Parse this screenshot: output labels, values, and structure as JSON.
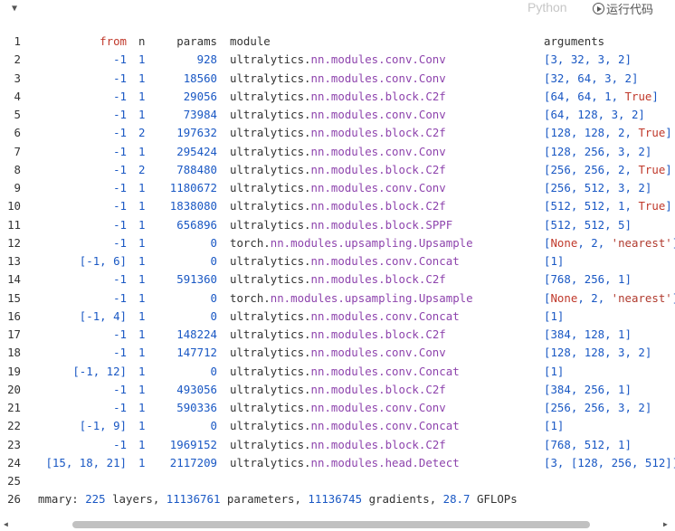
{
  "toolbar": {
    "language": "Python",
    "run_label": "运行代码"
  },
  "header": {
    "ln": "1",
    "from": "from",
    "n": "n",
    "params": "params",
    "module": "module",
    "arguments": "arguments"
  },
  "rows": [
    {
      "ln": "2",
      "from": "-1",
      "n": "1",
      "params": "928",
      "mod": [
        "ultralytics.",
        "nn.modules.conv.",
        "Conv"
      ],
      "args": "[3, 32, 3, 2]"
    },
    {
      "ln": "3",
      "from": "-1",
      "n": "1",
      "params": "18560",
      "mod": [
        "ultralytics.",
        "nn.modules.conv.",
        "Conv"
      ],
      "args": "[32, 64, 3, 2]"
    },
    {
      "ln": "4",
      "from": "-1",
      "n": "1",
      "params": "29056",
      "mod": [
        "ultralytics.",
        "nn.modules.block.",
        "C2f"
      ],
      "args": "[64, 64, 1, True]"
    },
    {
      "ln": "5",
      "from": "-1",
      "n": "1",
      "params": "73984",
      "mod": [
        "ultralytics.",
        "nn.modules.conv.",
        "Conv"
      ],
      "args": "[64, 128, 3, 2]"
    },
    {
      "ln": "6",
      "from": "-1",
      "n": "2",
      "params": "197632",
      "mod": [
        "ultralytics.",
        "nn.modules.block.",
        "C2f"
      ],
      "args": "[128, 128, 2, True]"
    },
    {
      "ln": "7",
      "from": "-1",
      "n": "1",
      "params": "295424",
      "mod": [
        "ultralytics.",
        "nn.modules.conv.",
        "Conv"
      ],
      "args": "[128, 256, 3, 2]"
    },
    {
      "ln": "8",
      "from": "-1",
      "n": "2",
      "params": "788480",
      "mod": [
        "ultralytics.",
        "nn.modules.block.",
        "C2f"
      ],
      "args": "[256, 256, 2, True]"
    },
    {
      "ln": "9",
      "from": "-1",
      "n": "1",
      "params": "1180672",
      "mod": [
        "ultralytics.",
        "nn.modules.conv.",
        "Conv"
      ],
      "args": "[256, 512, 3, 2]"
    },
    {
      "ln": "10",
      "from": "-1",
      "n": "1",
      "params": "1838080",
      "mod": [
        "ultralytics.",
        "nn.modules.block.",
        "C2f"
      ],
      "args": "[512, 512, 1, True]"
    },
    {
      "ln": "11",
      "from": "-1",
      "n": "1",
      "params": "656896",
      "mod": [
        "ultralytics.",
        "nn.modules.block.",
        "SPPF"
      ],
      "args": "[512, 512, 5]"
    },
    {
      "ln": "12",
      "from": "-1",
      "n": "1",
      "params": "0",
      "mod": [
        "torch.",
        "nn.modules.upsampling.",
        "Upsample"
      ],
      "args": "[None, 2, 'nearest']"
    },
    {
      "ln": "13",
      "from": "[-1, 6]",
      "n": "1",
      "params": "0",
      "mod": [
        "ultralytics.",
        "nn.modules.conv.",
        "Concat"
      ],
      "args": "[1]"
    },
    {
      "ln": "14",
      "from": "-1",
      "n": "1",
      "params": "591360",
      "mod": [
        "ultralytics.",
        "nn.modules.block.",
        "C2f"
      ],
      "args": "[768, 256, 1]"
    },
    {
      "ln": "15",
      "from": "-1",
      "n": "1",
      "params": "0",
      "mod": [
        "torch.",
        "nn.modules.upsampling.",
        "Upsample"
      ],
      "args": "[None, 2, 'nearest']"
    },
    {
      "ln": "16",
      "from": "[-1, 4]",
      "n": "1",
      "params": "0",
      "mod": [
        "ultralytics.",
        "nn.modules.conv.",
        "Concat"
      ],
      "args": "[1]"
    },
    {
      "ln": "17",
      "from": "-1",
      "n": "1",
      "params": "148224",
      "mod": [
        "ultralytics.",
        "nn.modules.block.",
        "C2f"
      ],
      "args": "[384, 128, 1]"
    },
    {
      "ln": "18",
      "from": "-1",
      "n": "1",
      "params": "147712",
      "mod": [
        "ultralytics.",
        "nn.modules.conv.",
        "Conv"
      ],
      "args": "[128, 128, 3, 2]"
    },
    {
      "ln": "19",
      "from": "[-1, 12]",
      "n": "1",
      "params": "0",
      "mod": [
        "ultralytics.",
        "nn.modules.conv.",
        "Concat"
      ],
      "args": "[1]"
    },
    {
      "ln": "20",
      "from": "-1",
      "n": "1",
      "params": "493056",
      "mod": [
        "ultralytics.",
        "nn.modules.block.",
        "C2f"
      ],
      "args": "[384, 256, 1]"
    },
    {
      "ln": "21",
      "from": "-1",
      "n": "1",
      "params": "590336",
      "mod": [
        "ultralytics.",
        "nn.modules.conv.",
        "Conv"
      ],
      "args": "[256, 256, 3, 2]"
    },
    {
      "ln": "22",
      "from": "[-1, 9]",
      "n": "1",
      "params": "0",
      "mod": [
        "ultralytics.",
        "nn.modules.conv.",
        "Concat"
      ],
      "args": "[1]"
    },
    {
      "ln": "23",
      "from": "-1",
      "n": "1",
      "params": "1969152",
      "mod": [
        "ultralytics.",
        "nn.modules.block.",
        "C2f"
      ],
      "args": "[768, 512, 1]"
    },
    {
      "ln": "24",
      "from": "[15, 18, 21]",
      "n": "1",
      "params": "2117209",
      "mod": [
        "ultralytics.",
        "nn.modules.head.",
        "Detect"
      ],
      "args": "[3, [128, 256, 512]]"
    }
  ],
  "blank_line": "25",
  "summary": {
    "ln": "26",
    "prefix": "mmary: ",
    "layers": "225",
    "layers_label": " layers, ",
    "parameters": "11136761",
    "parameters_label": " parameters, ",
    "gradients": "11136745",
    "gradients_label": " gradients, ",
    "gflops": "28.7",
    "gflops_label": " GFLOPs"
  },
  "colors": {
    "number": "#1a58c4",
    "keyword": "#c0392b",
    "module_path": "#8e44ad",
    "text": "#333333"
  }
}
